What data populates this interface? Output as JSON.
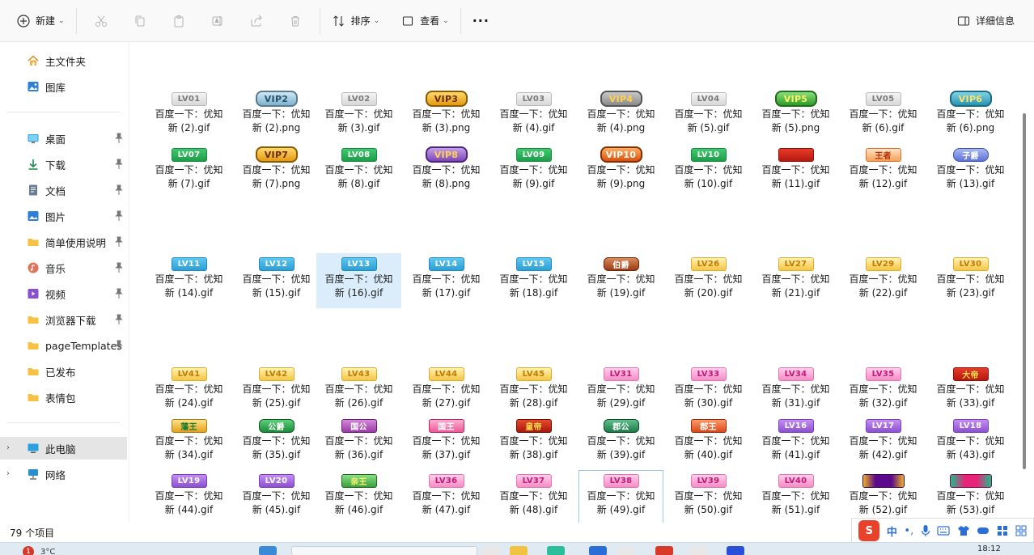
{
  "toolbar": {
    "new_label": "新建",
    "sort_label": "排序",
    "view_label": "查看",
    "more_label": "···",
    "details_label": "详细信息"
  },
  "sidebar": {
    "quick": [
      {
        "label": "主文件夹",
        "icon": "home-icon"
      },
      {
        "label": "图库",
        "icon": "gallery-icon"
      }
    ],
    "pinned": [
      {
        "label": "桌面",
        "icon": "desktop-icon"
      },
      {
        "label": "下载",
        "icon": "download-icon"
      },
      {
        "label": "文档",
        "icon": "document-icon"
      },
      {
        "label": "图片",
        "icon": "pictures-icon"
      },
      {
        "label": "简单使用说明",
        "icon": "folder-icon"
      },
      {
        "label": "音乐",
        "icon": "music-icon"
      },
      {
        "label": "视频",
        "icon": "video-icon"
      },
      {
        "label": "浏览器下载",
        "icon": "folder-icon"
      },
      {
        "label": "pageTemplates",
        "icon": "folder-icon"
      },
      {
        "label": "已发布",
        "icon": "folder-icon"
      },
      {
        "label": "表情包",
        "icon": "folder-icon"
      }
    ],
    "system": [
      {
        "label": "此电脑",
        "icon": "computer-icon"
      },
      {
        "label": "网络",
        "icon": "network-icon"
      }
    ]
  },
  "files": [
    {
      "name": "百度一下：优知\n新 (2).gif",
      "badge": "LV01",
      "style": "b-gray"
    },
    {
      "name": "百度一下：优知\n新 (2).png",
      "badge": "VIP2",
      "style": "b-vip b-vip2"
    },
    {
      "name": "百度一下：优知\n新 (3).gif",
      "badge": "LV02",
      "style": "b-gray"
    },
    {
      "name": "百度一下：优知\n新 (3).png",
      "badge": "VIP3",
      "style": "b-vip"
    },
    {
      "name": "百度一下：优知\n新 (4).gif",
      "badge": "LV03",
      "style": "b-gray"
    },
    {
      "name": "百度一下：优知\n新 (4).png",
      "badge": "VIP4",
      "style": "b-vip b-vip4"
    },
    {
      "name": "百度一下：优知\n新 (5).gif",
      "badge": "LV04",
      "style": "b-gray"
    },
    {
      "name": "百度一下：优知\n新 (5).png",
      "badge": "VIP5",
      "style": "b-vip b-vip5"
    },
    {
      "name": "百度一下：优知\n新 (6).gif",
      "badge": "LV05",
      "style": "b-gray"
    },
    {
      "name": "百度一下：优知\n新 (6).png",
      "badge": "VIP6",
      "style": "b-vip b-vip6"
    },
    {
      "name": "百度一下：优知\n新 (7).gif",
      "badge": "LV07",
      "style": "b-green"
    },
    {
      "name": "百度一下：优知\n新 (7).png",
      "badge": "VIP7",
      "style": "b-vip"
    },
    {
      "name": "百度一下：优知\n新 (8).gif",
      "badge": "LV08",
      "style": "b-green"
    },
    {
      "name": "百度一下：优知\n新 (8).png",
      "badge": "VIP8",
      "style": "b-vip b-vip8"
    },
    {
      "name": "百度一下：优知\n新 (9).gif",
      "badge": "LV09",
      "style": "b-green"
    },
    {
      "name": "百度一下：优知\n新 (9).png",
      "badge": "VIP10",
      "style": "b-vip b-vip10"
    },
    {
      "name": "百度一下：优知\n新 (10).gif",
      "badge": "LV10",
      "style": "b-green"
    },
    {
      "name": "百度一下：优知\n新 (11).gif",
      "badge": "",
      "style": "b-red"
    },
    {
      "name": "百度一下：优知\n新 (12).gif",
      "badge": "王者",
      "style": "b-title"
    },
    {
      "name": "百度一下：优知\n新 (13).gif",
      "badge": "子爵",
      "style": "b-zijue"
    },
    {
      "name": "百度一下：优知\n新 (14).gif",
      "badge": "LV11",
      "style": "b-blue"
    },
    {
      "name": "百度一下：优知\n新 (15).gif",
      "badge": "LV12",
      "style": "b-blue"
    },
    {
      "name": "百度一下：优知\n新 (16).gif",
      "badge": "LV13",
      "style": "b-blue"
    },
    {
      "name": "百度一下：优知\n新 (17).gif",
      "badge": "LV14",
      "style": "b-blue"
    },
    {
      "name": "百度一下：优知\n新 (18).gif",
      "badge": "LV15",
      "style": "b-blue"
    },
    {
      "name": "百度一下：优知\n新 (19).gif",
      "badge": "伯爵",
      "style": "b-bojue"
    },
    {
      "name": "百度一下：优知\n新 (20).gif",
      "badge": "LV26",
      "style": "b-gold"
    },
    {
      "name": "百度一下：优知\n新 (21).gif",
      "badge": "LV27",
      "style": "b-gold"
    },
    {
      "name": "百度一下：优知\n新 (22).gif",
      "badge": "LV29",
      "style": "b-gold"
    },
    {
      "name": "百度一下：优知\n新 (23).gif",
      "badge": "LV30",
      "style": "b-gold"
    },
    {
      "name": "百度一下：优知\n新 (24).gif",
      "badge": "LV41",
      "style": "b-gold"
    },
    {
      "name": "百度一下：优知\n新 (25).gif",
      "badge": "LV42",
      "style": "b-gold"
    },
    {
      "name": "百度一下：优知\n新 (26).gif",
      "badge": "LV43",
      "style": "b-gold"
    },
    {
      "name": "百度一下：优知\n新 (27).gif",
      "badge": "LV44",
      "style": "b-gold"
    },
    {
      "name": "百度一下：优知\n新 (28).gif",
      "badge": "LV45",
      "style": "b-gold"
    },
    {
      "name": "百度一下：优知\n新 (29).gif",
      "badge": "LV31",
      "style": "b-pink"
    },
    {
      "name": "百度一下：优知\n新 (30).gif",
      "badge": "LV33",
      "style": "b-pink"
    },
    {
      "name": "百度一下：优知\n新 (31).gif",
      "badge": "LV34",
      "style": "b-pink"
    },
    {
      "name": "百度一下：优知\n新 (32).gif",
      "badge": "LV35",
      "style": "b-pink"
    },
    {
      "name": "百度一下：优知\n新 (33).gif",
      "badge": "大帝",
      "style": "b-red"
    },
    {
      "name": "百度一下：优知\n新 (34).gif",
      "badge": "藩王",
      "style": "b-fan"
    },
    {
      "name": "百度一下：优知\n新 (35).gif",
      "badge": "公爵",
      "style": "b-gongjue"
    },
    {
      "name": "百度一下：优知\n新 (36).gif",
      "badge": "国公",
      "style": "b-guogong"
    },
    {
      "name": "百度一下：优知\n新 (37).gif",
      "badge": "国王",
      "style": "b-guowang"
    },
    {
      "name": "百度一下：优知\n新 (38).gif",
      "badge": "皇帝",
      "style": "b-huangdi"
    },
    {
      "name": "百度一下：优知\n新 (39).gif",
      "badge": "郡公",
      "style": "b-jungong"
    },
    {
      "name": "百度一下：优知\n新 (40).gif",
      "badge": "郡王",
      "style": "b-junwang"
    },
    {
      "name": "百度一下：优知\n新 (41).gif",
      "badge": "LV16",
      "style": "b-purple"
    },
    {
      "name": "百度一下：优知\n新 (42).gif",
      "badge": "LV17",
      "style": "b-purple"
    },
    {
      "name": "百度一下：优知\n新 (43).gif",
      "badge": "LV18",
      "style": "b-purple"
    },
    {
      "name": "百度一下：优知\n新 (44).gif",
      "badge": "LV19",
      "style": "b-purple"
    },
    {
      "name": "百度一下：优知\n新 (45).gif",
      "badge": "LV20",
      "style": "b-purple"
    },
    {
      "name": "百度一下：优知\n新 (46).gif",
      "badge": "亲王",
      "style": "b-qinwang"
    },
    {
      "name": "百度一下：优知\n新 (47).gif",
      "badge": "LV36",
      "style": "b-pink"
    },
    {
      "name": "百度一下：优知\n新 (48).gif",
      "badge": "LV37",
      "style": "b-pink"
    },
    {
      "name": "百度一下：优知\n新 (49).gif",
      "badge": "LV38",
      "style": "b-pink"
    },
    {
      "name": "百度一下：优知\n新 (50).gif",
      "badge": "LV39",
      "style": "b-pink"
    },
    {
      "name": "百度一下：优知\n新 (51).gif",
      "badge": "LV40",
      "style": "b-pink"
    },
    {
      "name": "百度一下：优知\n新 (52).gif",
      "badge": "",
      "style": "b-blank1"
    },
    {
      "name": "百度一下：优知\n新 (53).gif",
      "badge": "",
      "style": "b-blank2"
    }
  ],
  "status": {
    "item_count": "79 个项目"
  },
  "ime": {
    "logo": "S",
    "mode": "中"
  },
  "taskbar": {
    "weather": "3°C",
    "notification_count": "1",
    "clock": "18:12"
  }
}
